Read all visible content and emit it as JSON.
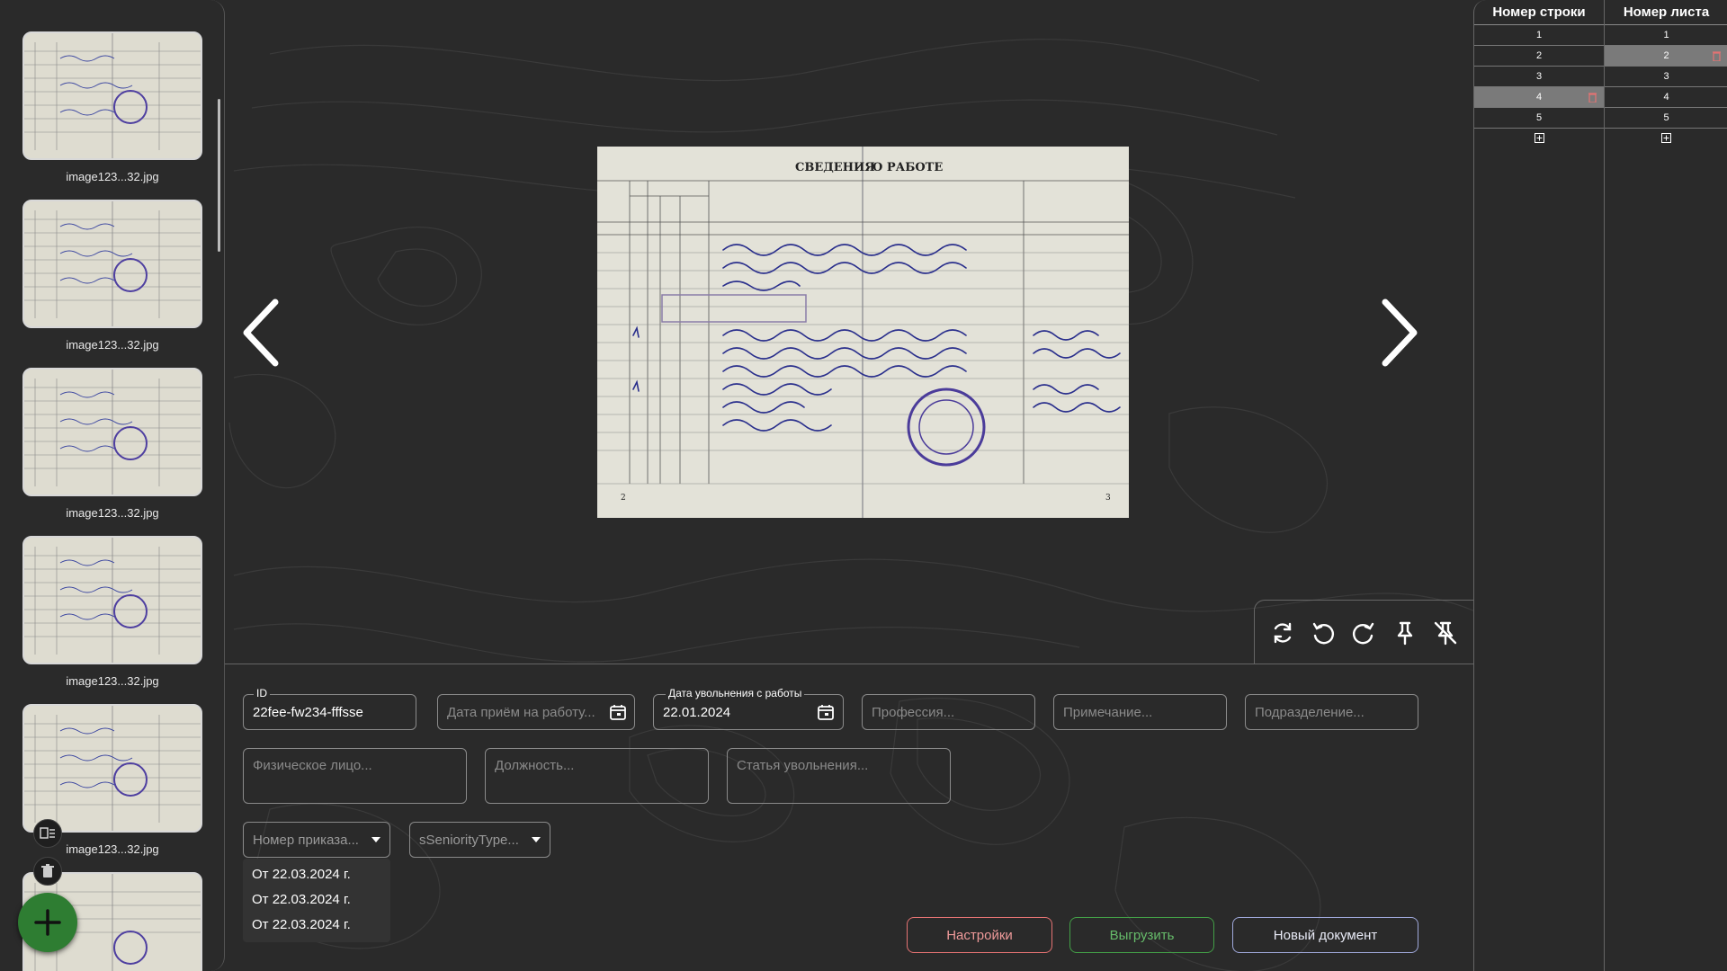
{
  "sidebar": {
    "thumbnails": [
      {
        "caption": "image123...32.jpg"
      },
      {
        "caption": "image123...32.jpg"
      },
      {
        "caption": "image123...32.jpg"
      },
      {
        "caption": "image123...32.jpg"
      },
      {
        "caption": "image123...32.jpg"
      }
    ],
    "buttons": [
      "select-all-icon",
      "trash-icon",
      "plus-icon"
    ]
  },
  "document": {
    "header_left": "СВЕДЕНИЯ",
    "header_right": "О РАБОТЕ",
    "page_left": "2",
    "page_right": "3"
  },
  "toolbar": [
    "refresh-icon",
    "rotate-left-icon",
    "rotate-right-icon",
    "pin-icon",
    "unpin-icon"
  ],
  "form": {
    "id": {
      "legend": "ID",
      "value": "22fee-fw234-fffsse"
    },
    "hire_date": {
      "placeholder": "Дата приём на работу..."
    },
    "dismissal_date": {
      "legend": "Дата увольнения с работы",
      "value": "22.01.2024"
    },
    "profession": {
      "placeholder": "Профессия..."
    },
    "note": {
      "placeholder": "Примечание..."
    },
    "department": {
      "placeholder": "Подразделение..."
    },
    "person": {
      "placeholder": "Физическое лицо..."
    },
    "position": {
      "placeholder": "Должность..."
    },
    "dismissal_article": {
      "placeholder": "Статья увольнения..."
    },
    "order_number": {
      "placeholder": "Номер приказа..."
    },
    "seniority": {
      "placeholder": "sSeniorityType..."
    },
    "dropdown_options": [
      "От 22.03.2024 г.",
      "От 22.03.2024 г.",
      "От 22.03.2024 г."
    ]
  },
  "actions": {
    "settings": "Настройки",
    "export": "Выгрузить",
    "new_document": "Новый документ"
  },
  "table": {
    "col1_header": "Номер строки",
    "col2_header": "Номер листа",
    "rows": [
      {
        "line": "1",
        "sheet": "1"
      },
      {
        "line": "2",
        "sheet": "2"
      },
      {
        "line": "3",
        "sheet": "3"
      },
      {
        "line": "4",
        "sheet": "4"
      },
      {
        "line": "5",
        "sheet": "5"
      }
    ]
  },
  "colors": {
    "background": "#2a2a2a",
    "settings_border": "#e57373",
    "export_border": "#43a047",
    "new_doc_border": "#9fa8da",
    "fab": "#2e7d32",
    "delete": "#e57373"
  }
}
